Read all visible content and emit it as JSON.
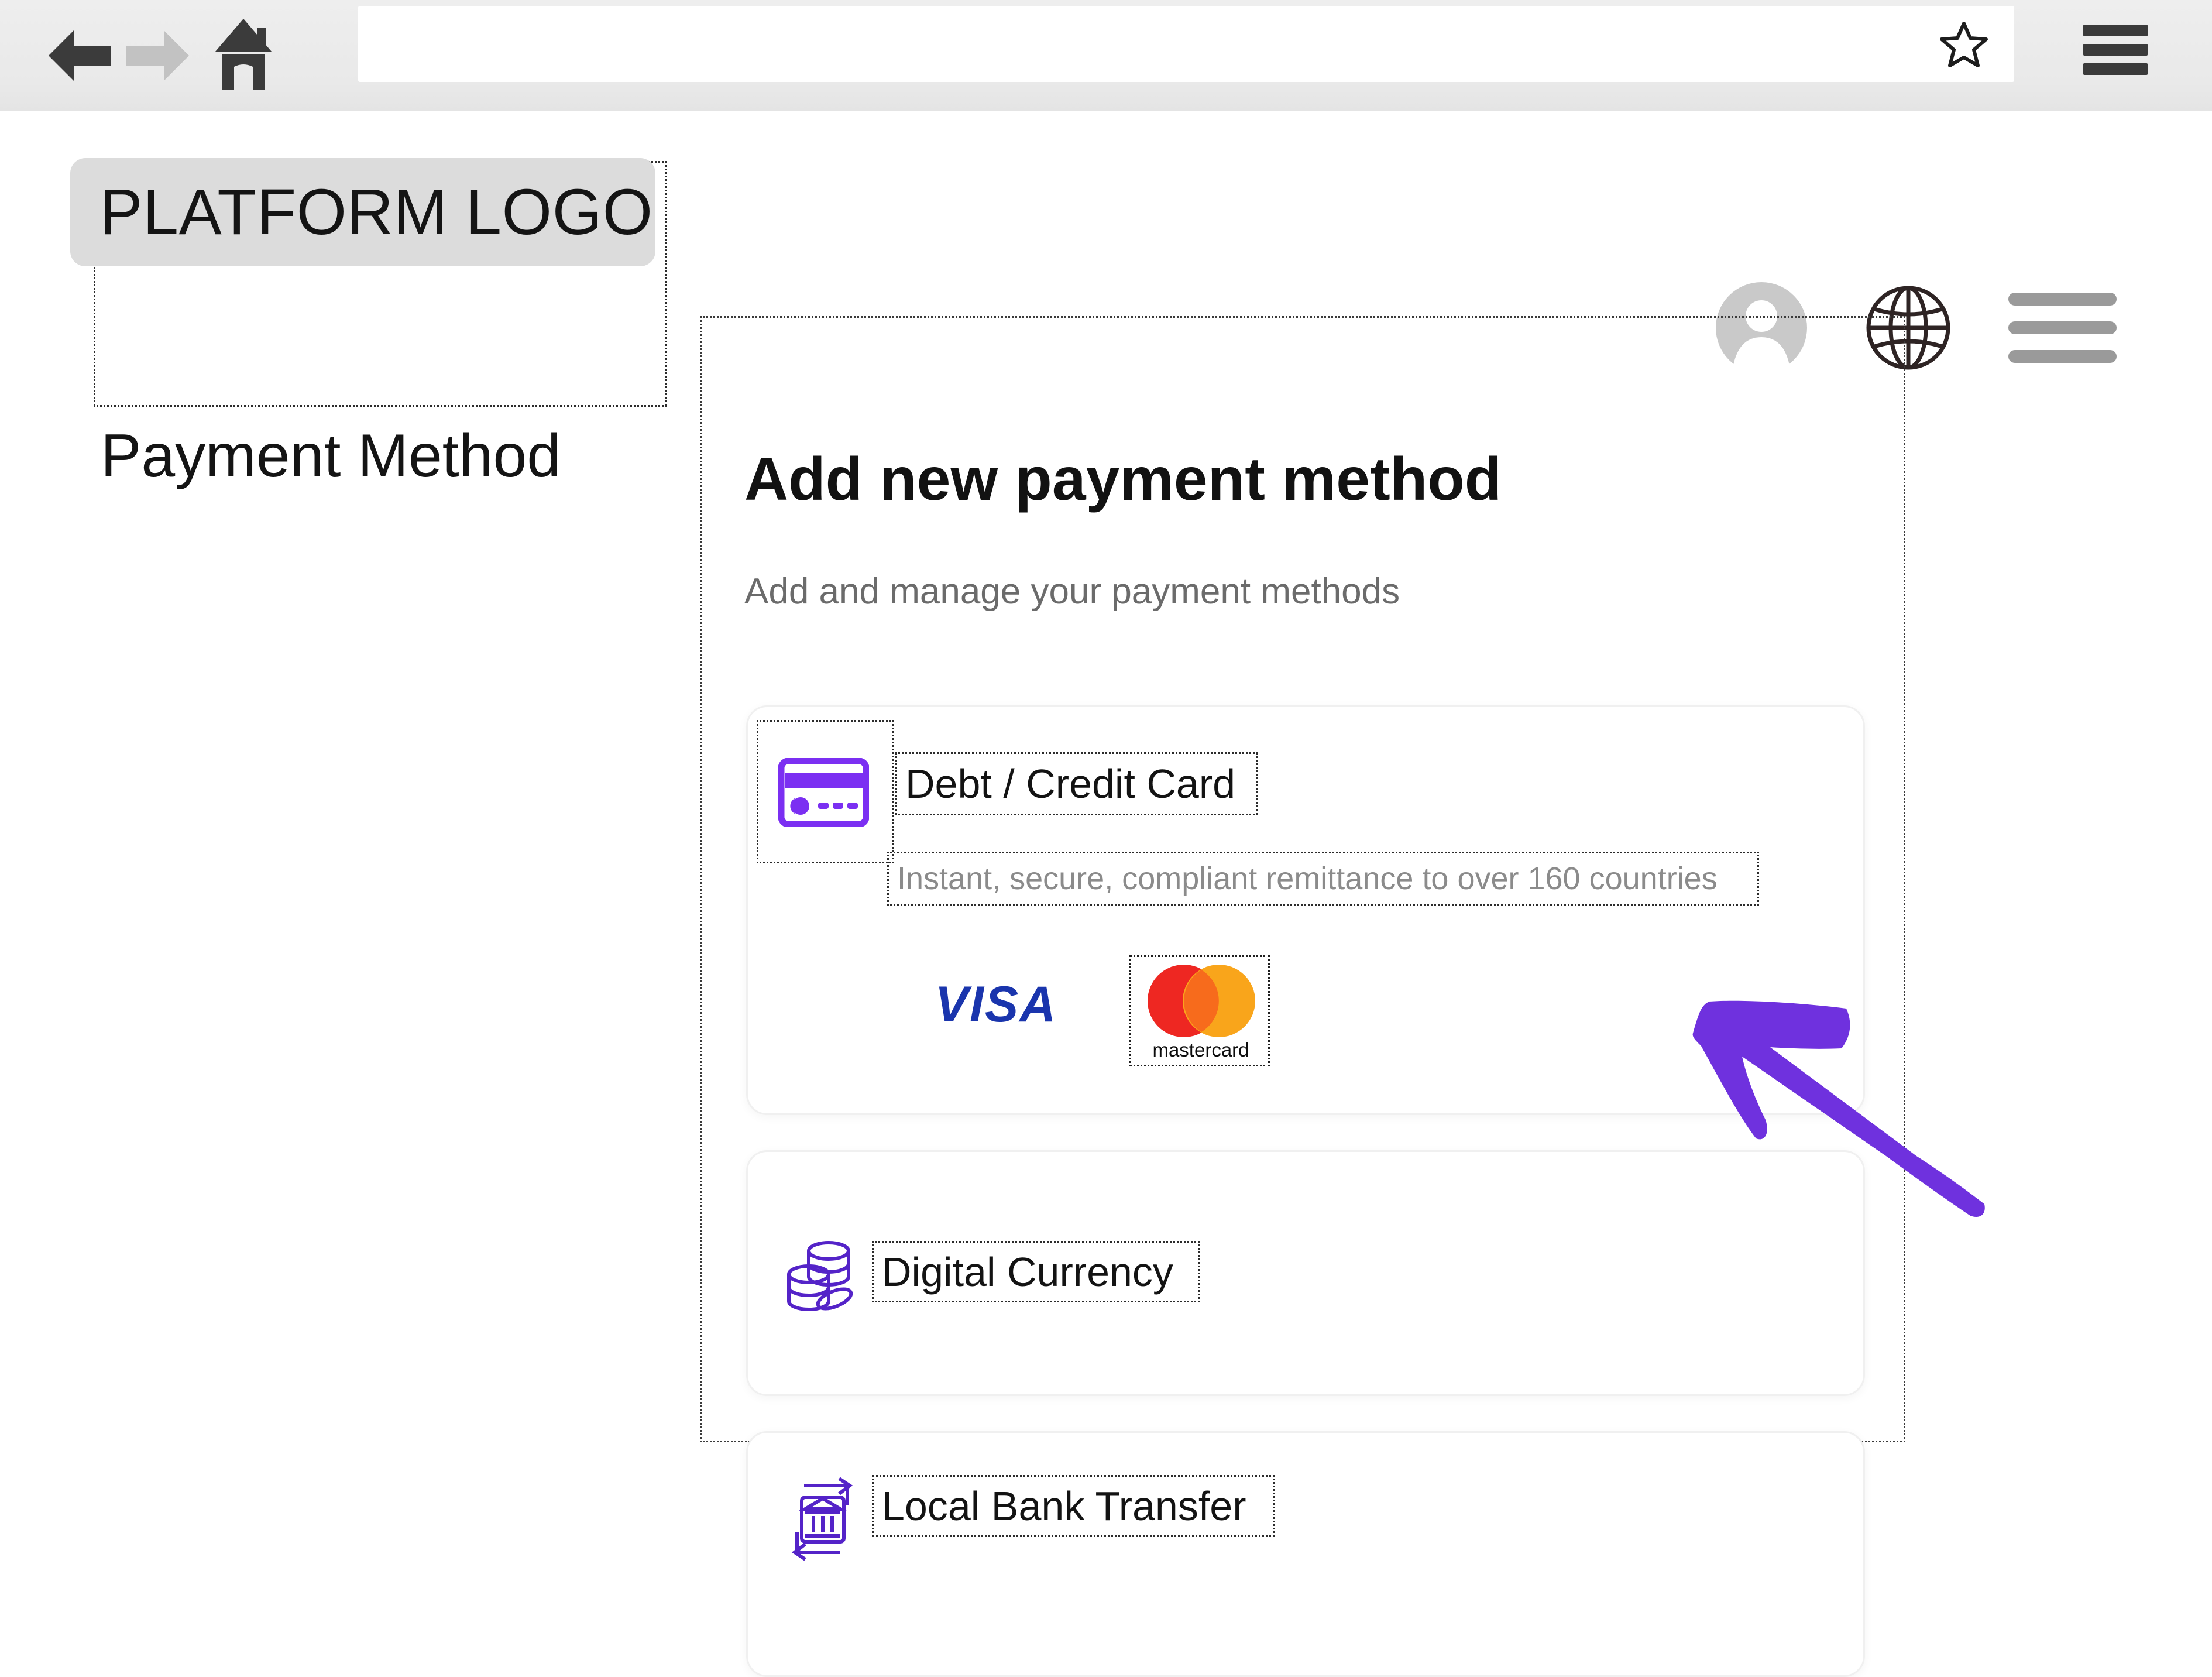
{
  "browser": {
    "back_icon": "arrow-left-icon",
    "forward_icon": "arrow-right-icon",
    "home_icon": "home-icon",
    "url_value": "",
    "url_placeholder": "",
    "bookmark_icon": "star-icon",
    "menu_icon": "hamburger-menu-icon"
  },
  "header": {
    "logo_text": "PLATFORM LOGO",
    "page_title": "Payment Method",
    "avatar_icon": "user-avatar-icon",
    "language_icon": "globe-icon",
    "menu_icon": "hamburger-menu-icon"
  },
  "main": {
    "heading": "Add new payment method",
    "subheading": "Add and manage your payment methods",
    "methods": [
      {
        "id": "debit-credit-card",
        "icon": "credit-card-icon",
        "label": "Debt / Credit Card",
        "description": "Instant, secure, compliant remittance to over 160 countries",
        "brands": [
          {
            "name": "VISA",
            "text": "VISA"
          },
          {
            "name": "mastercard",
            "text": "mastercard"
          }
        ]
      },
      {
        "id": "digital-currency",
        "icon": "coin-stack-icon",
        "label": "Digital Currency",
        "description": "",
        "brands": []
      },
      {
        "id": "local-bank-transfer",
        "icon": "bank-transfer-icon",
        "label": "Local Bank Transfer",
        "description": "",
        "brands": []
      }
    ]
  },
  "annotation": {
    "arrow_icon": "pointer-arrow-icon",
    "arrow_color": "#6F31DE"
  },
  "colors": {
    "accent_purple": "#6F31DE",
    "icon_purple": "#7B2FF2",
    "visa_blue": "#1A35AD",
    "mastercard_red": "#EE2722",
    "mastercard_orange": "#F9A51B",
    "mastercard_overlap": "#F76B1C",
    "toolbar_gray": "#EBEBEB",
    "logo_chip_gray": "#DCDCDC",
    "text_muted": "#8B8B8B"
  }
}
